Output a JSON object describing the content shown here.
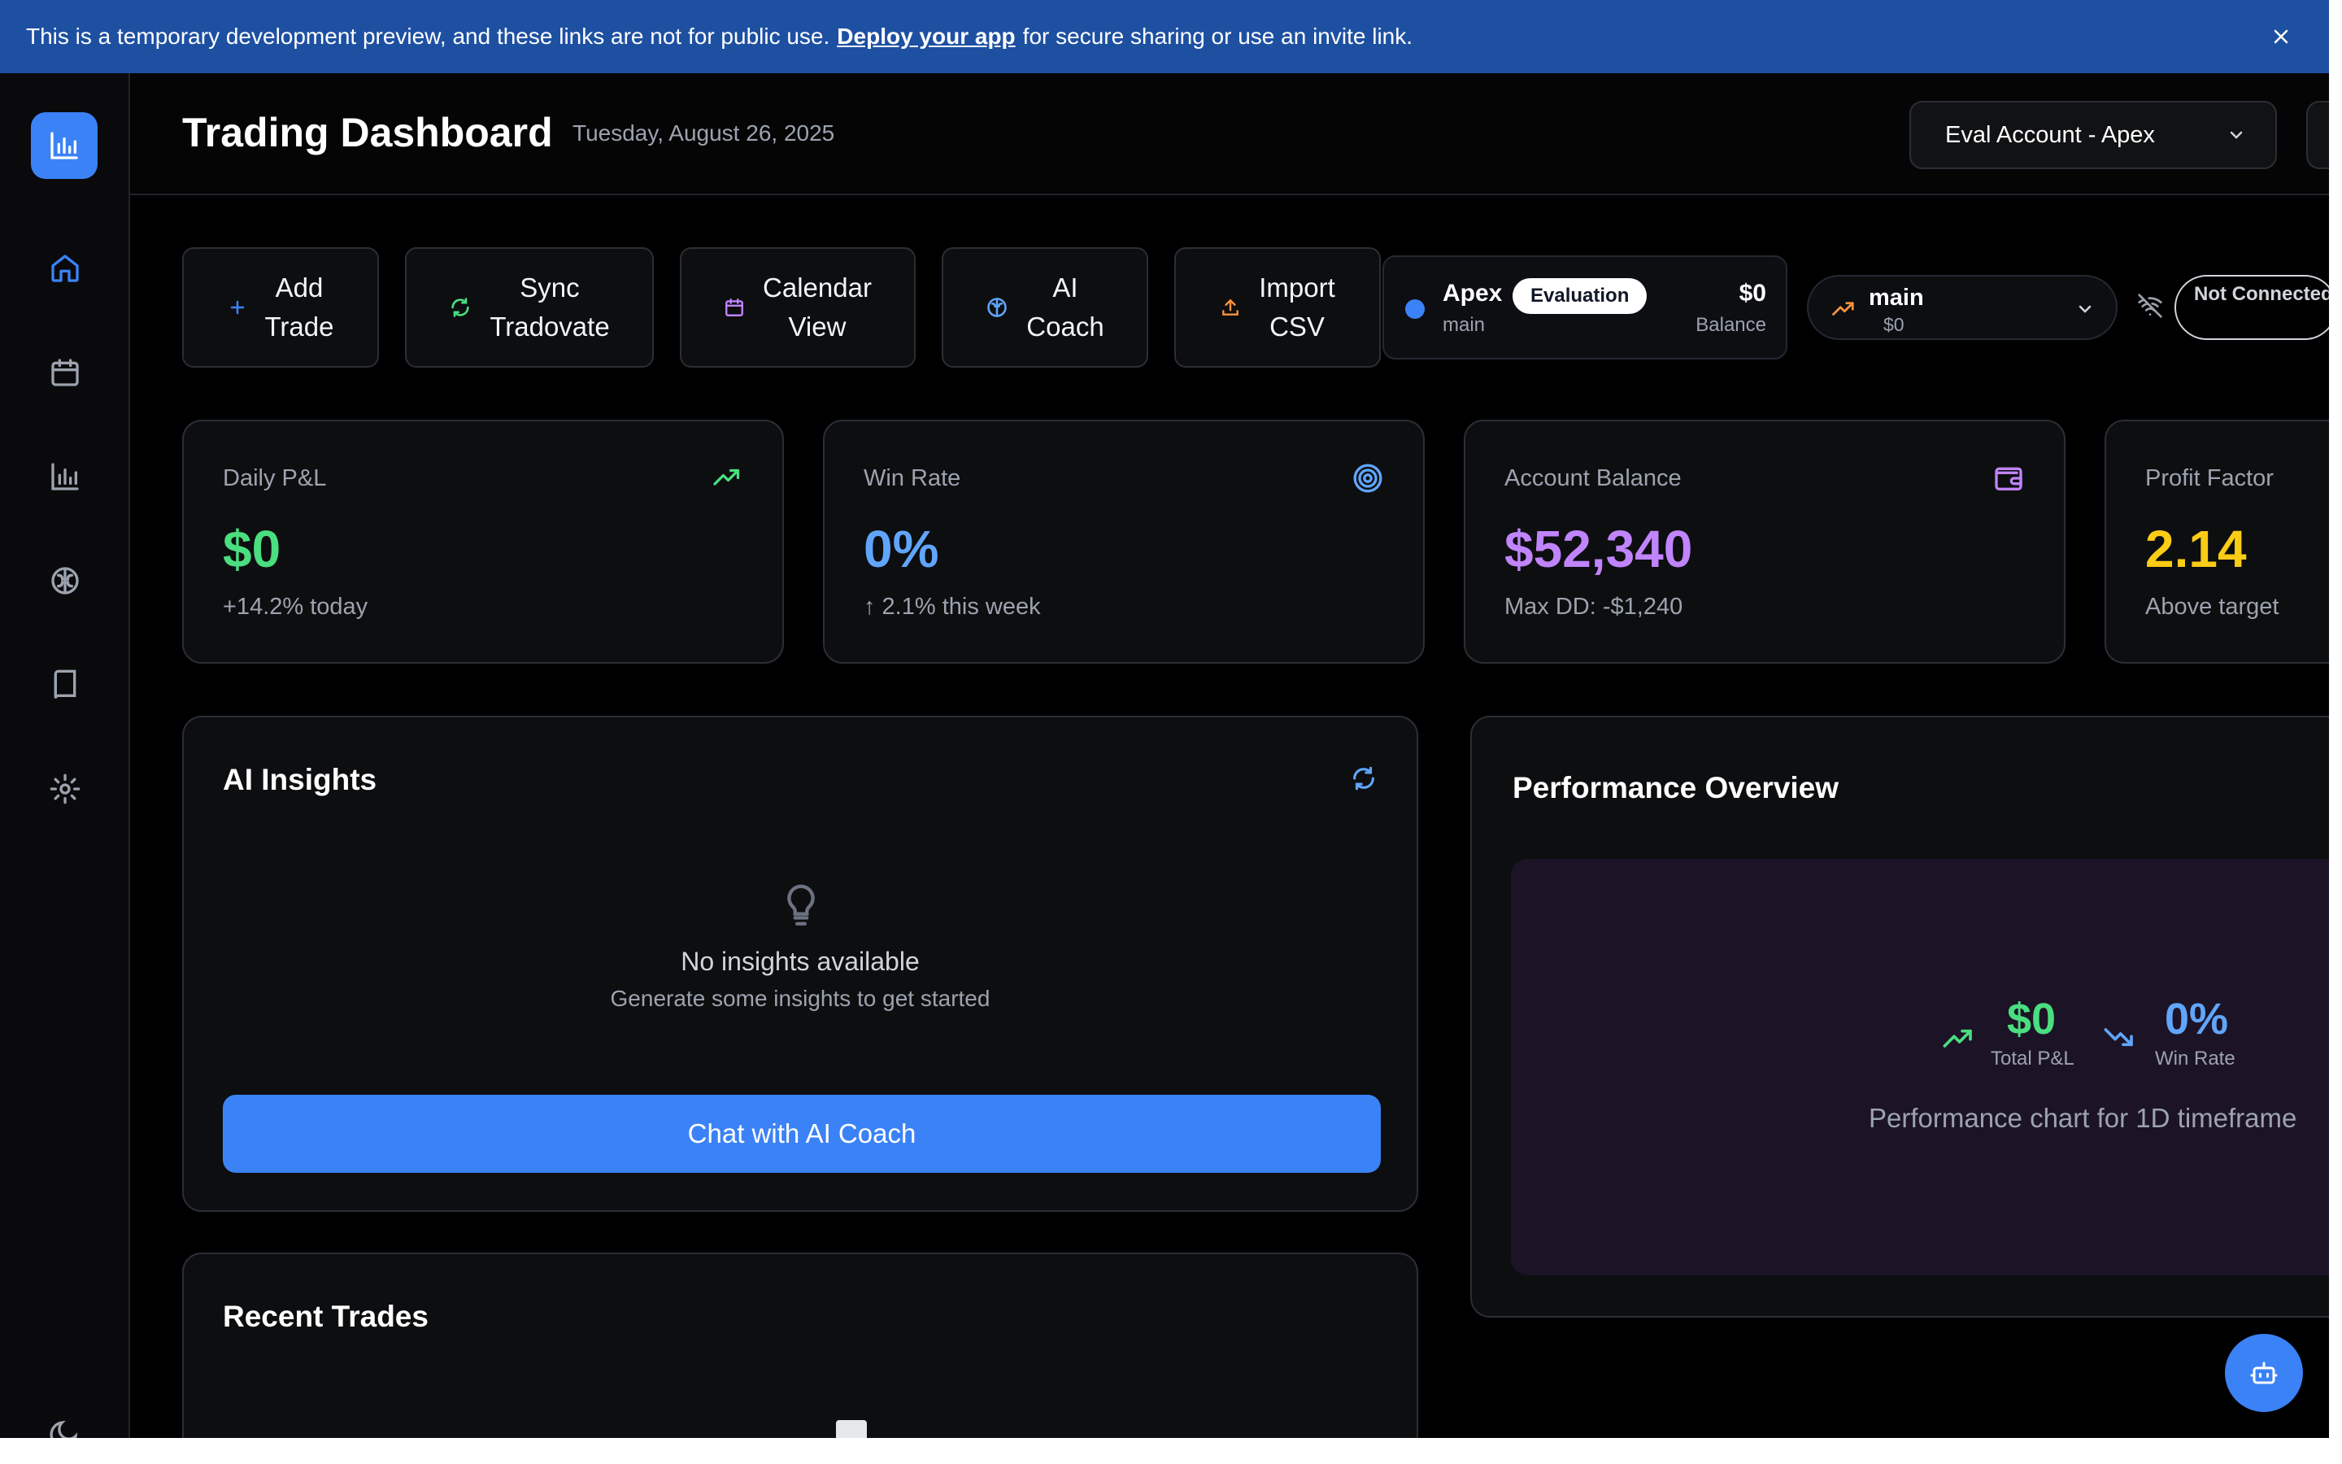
{
  "banner": {
    "text_before": "This is a temporary development preview, and these links are not for public use.",
    "link_text": "Deploy your app",
    "text_after": "for secure sharing or use an invite link."
  },
  "sidebar": {
    "items": [
      {
        "name": "home",
        "icon": "home-icon",
        "active": true
      },
      {
        "name": "calendar",
        "icon": "calendar-icon"
      },
      {
        "name": "analytics",
        "icon": "bar-chart-icon"
      },
      {
        "name": "ai-coach",
        "icon": "brain-icon"
      },
      {
        "name": "journal",
        "icon": "book-icon"
      },
      {
        "name": "settings",
        "icon": "gear-icon"
      }
    ]
  },
  "header": {
    "title": "Trading Dashboard",
    "date": "Tuesday, August 26, 2025",
    "account_select": "Eval Account - Apex"
  },
  "actions": [
    {
      "label": "Add Trade",
      "icon": "plus-icon",
      "color": "#3b82f6"
    },
    {
      "label": "Sync Tradovate",
      "icon": "refresh-icon",
      "color": "#4ade80"
    },
    {
      "label": "Calendar View",
      "icon": "calendar-icon",
      "color": "#c084fc"
    },
    {
      "label": "AI Coach",
      "icon": "brain-icon",
      "color": "#60a5fa"
    },
    {
      "label": "Import CSV",
      "icon": "upload-icon",
      "color": "#fb923c"
    }
  ],
  "apex_account": {
    "name": "Apex",
    "badge": "Evaluation",
    "branch": "main",
    "balance": "$0",
    "balance_label": "Balance"
  },
  "branch_select": {
    "name": "main",
    "value": "$0"
  },
  "connection": {
    "status": "Not Connected"
  },
  "stats": [
    {
      "label": "Daily P&L",
      "value": "$0",
      "sub": "+14.2% today",
      "color": "#4ade80",
      "icon": "trending-up-icon"
    },
    {
      "label": "Win Rate",
      "value": "0%",
      "sub": "↑ 2.1% this week",
      "color": "#60a5fa",
      "icon": "target-icon"
    },
    {
      "label": "Account Balance",
      "value": "$52,340",
      "sub": "Max DD: -$1,240",
      "color": "#c084fc",
      "icon": "wallet-icon"
    },
    {
      "label": "Profit Factor",
      "value": "2.14",
      "sub": "Above target",
      "color": "#facc15",
      "icon": "none"
    }
  ],
  "ai_insights": {
    "title": "AI Insights",
    "empty_title": "No insights available",
    "empty_sub": "Generate some insights to get started",
    "chat_button": "Chat with AI Coach"
  },
  "performance": {
    "title": "Performance Overview",
    "total_pnl": "$0",
    "total_pnl_label": "Total P&L",
    "win_rate": "0%",
    "win_rate_label": "Win Rate",
    "caption": "Performance chart for 1D timeframe"
  },
  "recent_trades": {
    "title": "Recent Trades"
  }
}
